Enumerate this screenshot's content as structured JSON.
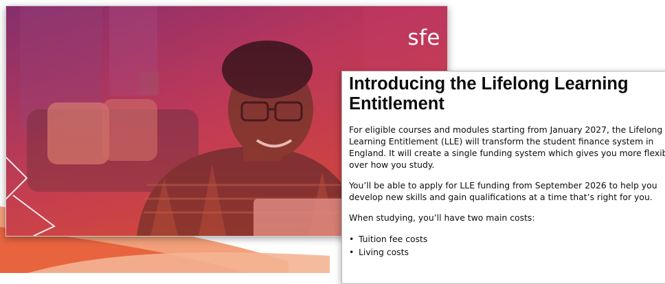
{
  "brand": {
    "logo_text": "sfe",
    "accent_colors": [
      "#c2185b",
      "#e8503a",
      "#f08a5d"
    ]
  },
  "hero": {
    "image_description_icon": "student-using-laptop-photo"
  },
  "article": {
    "title": "Introducing the Lifelong Learning Entitlement",
    "paragraph1_lines": [
      "For eligible courses and modules starting from January 2027, the Lifelong",
      "Learning Entitlement (LLE) will transform the student finance system in",
      "England. It will create a single funding system which gives you more flexibility",
      "over how you study."
    ],
    "paragraph2_lines": [
      "You’ll be able to apply for LLE funding from September 2026 to help you",
      "develop new skills and gain qualifications at a time that’s right for you."
    ],
    "paragraph3": "When studying, you’ll have two main costs:",
    "bullet_char": "•",
    "costs": [
      "Tuition fee costs",
      "Living costs"
    ]
  }
}
